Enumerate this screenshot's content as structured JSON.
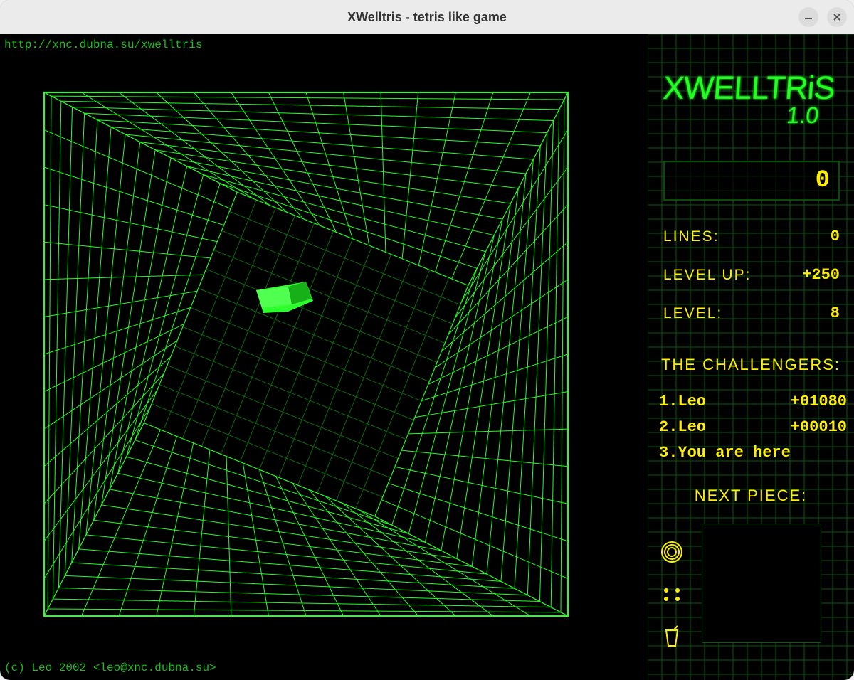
{
  "window": {
    "title": "XWelltris - tetris like game"
  },
  "header": {
    "url": "http://xnc.dubna.su/xwelltris",
    "copyright": "(c) Leo 2002 <leo@xnc.dubna.su>"
  },
  "logo": {
    "title": "XWELLTRIS",
    "version": "1.0"
  },
  "score": {
    "value": "0"
  },
  "stats": {
    "lines_label": "LINES:",
    "lines_value": "0",
    "levelup_label": "LEVEL UP:",
    "levelup_value": "+250",
    "level_label": "LEVEL:",
    "level_value": "8"
  },
  "challengers": {
    "title": "THE CHALLENGERS:",
    "rows": [
      {
        "rank": "1",
        "name": "Leo",
        "score": "+01080"
      },
      {
        "rank": "2",
        "name": "Leo",
        "score": "+00010"
      },
      {
        "rank": "3",
        "name": "You are here",
        "score": ""
      }
    ]
  },
  "next_piece": {
    "title": "NEXT PIECE:"
  },
  "colors": {
    "green_bright": "#24ff24",
    "green_dark": "#0a6a0a",
    "yellow": "#ffee00"
  },
  "icons": {
    "spiral": "spiral-icon",
    "shuffle": "shuffle-icon",
    "drink": "drink-icon"
  }
}
